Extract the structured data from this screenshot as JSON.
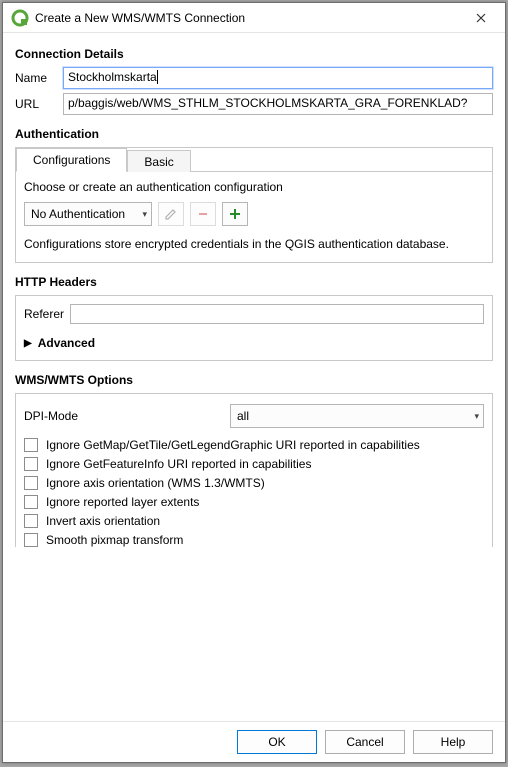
{
  "window": {
    "title": "Create a New WMS/WMTS Connection"
  },
  "connection": {
    "heading": "Connection Details",
    "name_label": "Name",
    "name_value": "Stockholmskarta",
    "url_label": "URL",
    "url_value": "p/baggis/web/WMS_STHLM_STOCKHOLMSKARTA_GRA_FORENKLAD?"
  },
  "auth": {
    "heading": "Authentication",
    "tabs": {
      "configurations": "Configurations",
      "basic": "Basic"
    },
    "choose_msg": "Choose or create an authentication configuration",
    "dropdown_value": "No Authentication",
    "note": "Configurations store encrypted credentials in the QGIS authentication database."
  },
  "http": {
    "heading": "HTTP Headers",
    "referer_label": "Referer",
    "referer_value": "",
    "advanced_label": "Advanced"
  },
  "wms": {
    "heading": "WMS/WMTS Options",
    "dpi_label": "DPI-Mode",
    "dpi_value": "all",
    "checks": [
      "Ignore GetMap/GetTile/GetLegendGraphic URI reported in capabilities",
      "Ignore GetFeatureInfo URI reported in capabilities",
      "Ignore axis orientation (WMS 1.3/WMTS)",
      "Ignore reported layer extents",
      "Invert axis orientation",
      "Smooth pixmap transform"
    ]
  },
  "buttons": {
    "ok": "OK",
    "cancel": "Cancel",
    "help": "Help"
  }
}
